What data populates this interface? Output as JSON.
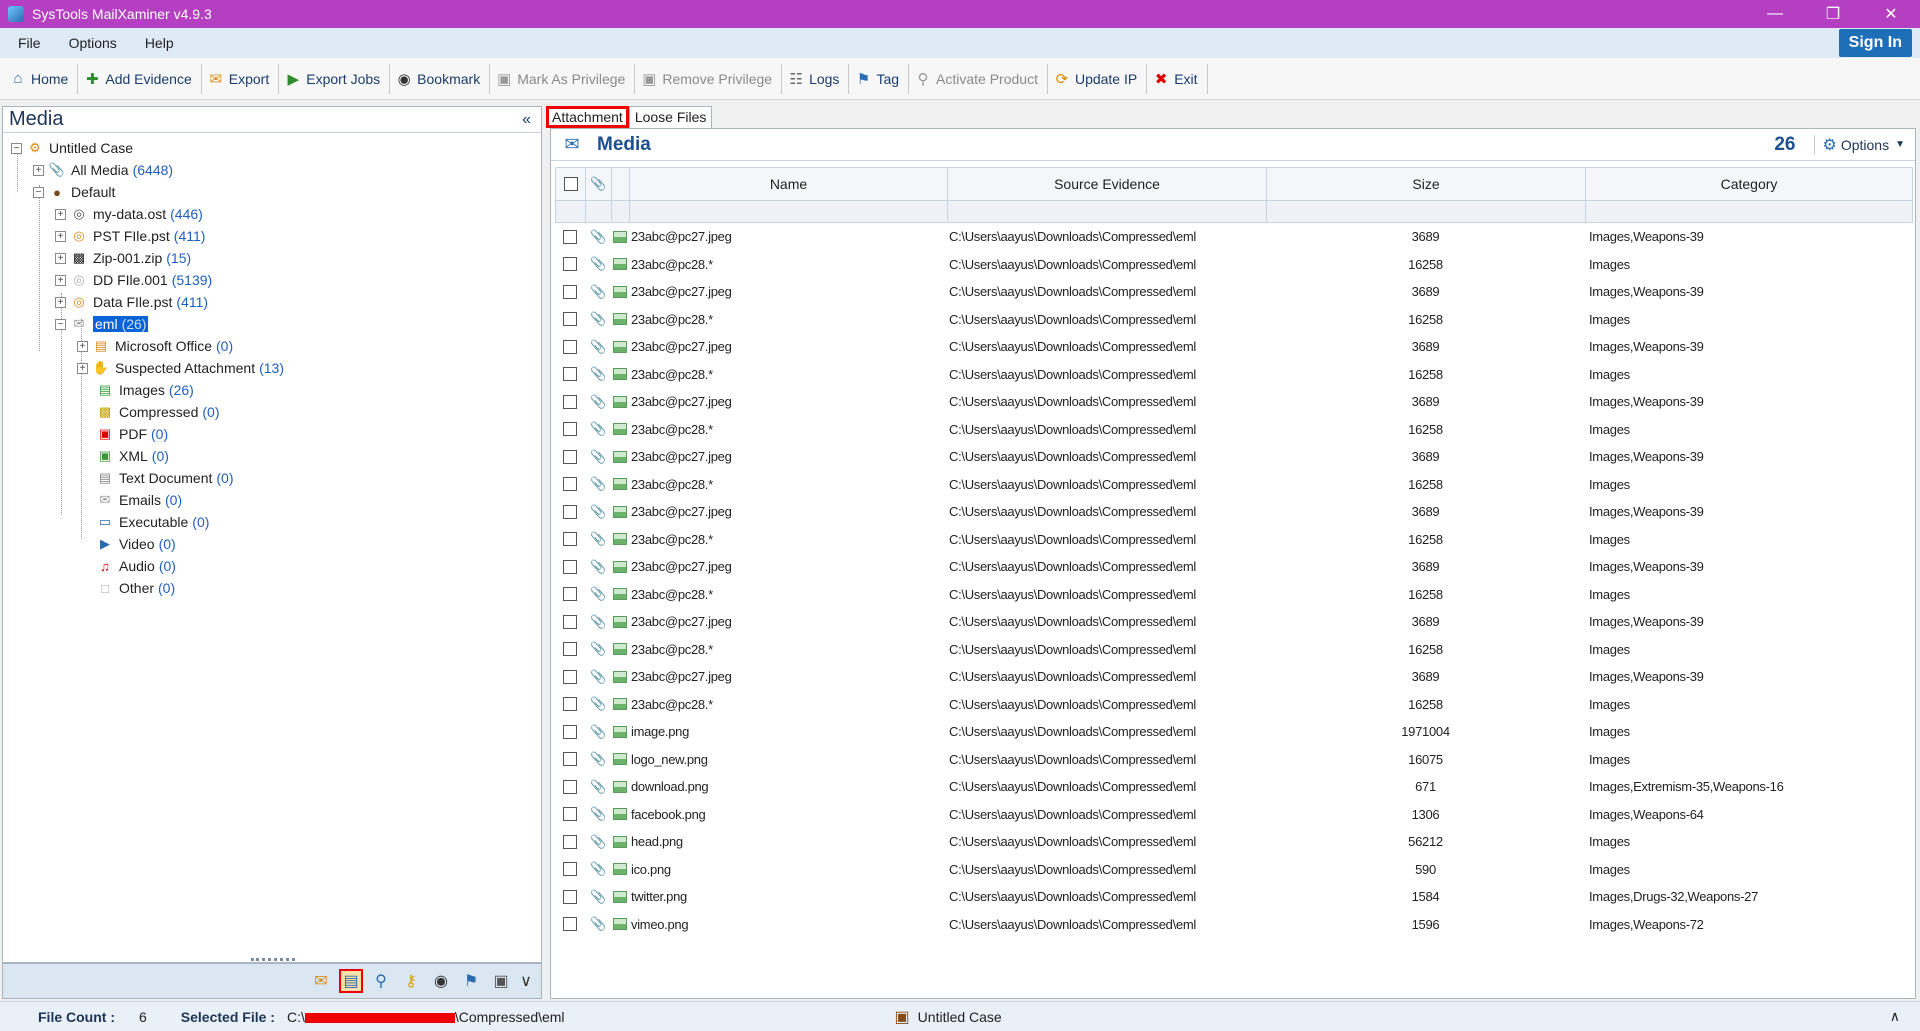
{
  "window": {
    "title": "SysTools MailXaminer v4.9.3"
  },
  "menu": {
    "items": [
      "File",
      "Options",
      "Help"
    ],
    "sign_in": "Sign In"
  },
  "toolbar": {
    "buttons": [
      {
        "label": "Home",
        "icon": "home-icon",
        "enabled": true
      },
      {
        "label": "Add Evidence",
        "icon": "add-evidence-icon",
        "enabled": true
      },
      {
        "label": "Export",
        "icon": "export-icon",
        "enabled": true
      },
      {
        "label": "Export Jobs",
        "icon": "play-icon",
        "enabled": true
      },
      {
        "label": "Bookmark",
        "icon": "eye-icon",
        "enabled": true
      },
      {
        "label": "Mark As Privilege",
        "icon": "lock-icon",
        "enabled": false
      },
      {
        "label": "Remove Privilege",
        "icon": "unlock-icon",
        "enabled": false
      },
      {
        "label": "Logs",
        "icon": "log-icon",
        "enabled": true
      },
      {
        "label": "Tag",
        "icon": "tag-icon",
        "enabled": true
      },
      {
        "label": "Activate Product",
        "icon": "key-icon",
        "enabled": false
      },
      {
        "label": "Update IP",
        "icon": "update-icon",
        "enabled": true
      },
      {
        "label": "Exit",
        "icon": "close-icon",
        "enabled": true
      }
    ]
  },
  "left_panel": {
    "title": "Media",
    "tree": {
      "case": "Untitled Case",
      "all_media": {
        "label": "All Media",
        "count": "(6448)"
      },
      "default": "Default",
      "sources": [
        {
          "label": "my-data.ost",
          "count": "(446)"
        },
        {
          "label": "PST FIle.pst",
          "count": "(411)"
        },
        {
          "label": "Zip-001.zip",
          "count": "(15)"
        },
        {
          "label": "DD FIle.001",
          "count": "(5139)"
        },
        {
          "label": "Data FIle.pst",
          "count": "(411)"
        },
        {
          "label": "eml",
          "count": "(26)"
        }
      ],
      "categories": [
        {
          "label": "Microsoft Office",
          "count": "(0)"
        },
        {
          "label": "Suspected Attachment",
          "count": "(13)"
        },
        {
          "label": "Images",
          "count": "(26)"
        },
        {
          "label": "Compressed",
          "count": "(0)"
        },
        {
          "label": "PDF",
          "count": "(0)"
        },
        {
          "label": "XML",
          "count": "(0)"
        },
        {
          "label": "Text Document",
          "count": "(0)"
        },
        {
          "label": "Emails",
          "count": "(0)"
        },
        {
          "label": "Executable",
          "count": "(0)"
        },
        {
          "label": "Video",
          "count": "(0)"
        },
        {
          "label": "Audio",
          "count": "(0)"
        },
        {
          "label": "Other",
          "count": "(0)"
        }
      ]
    }
  },
  "tabs": [
    "Attachment",
    "Loose Files"
  ],
  "media": {
    "title": "Media",
    "count": "26",
    "options_label": "Options"
  },
  "grid": {
    "columns": [
      "Name",
      "Source Evidence",
      "Size",
      "Category"
    ],
    "rows": [
      {
        "name": "23abc@pc27.jpeg",
        "source": "C:\\Users\\aayus\\Downloads\\Compressed\\eml",
        "size": "3689",
        "category": "Images,Weapons-39"
      },
      {
        "name": "23abc@pc28.*",
        "source": "C:\\Users\\aayus\\Downloads\\Compressed\\eml",
        "size": "16258",
        "category": "Images"
      },
      {
        "name": "23abc@pc27.jpeg",
        "source": "C:\\Users\\aayus\\Downloads\\Compressed\\eml",
        "size": "3689",
        "category": "Images,Weapons-39"
      },
      {
        "name": "23abc@pc28.*",
        "source": "C:\\Users\\aayus\\Downloads\\Compressed\\eml",
        "size": "16258",
        "category": "Images"
      },
      {
        "name": "23abc@pc27.jpeg",
        "source": "C:\\Users\\aayus\\Downloads\\Compressed\\eml",
        "size": "3689",
        "category": "Images,Weapons-39"
      },
      {
        "name": "23abc@pc28.*",
        "source": "C:\\Users\\aayus\\Downloads\\Compressed\\eml",
        "size": "16258",
        "category": "Images"
      },
      {
        "name": "23abc@pc27.jpeg",
        "source": "C:\\Users\\aayus\\Downloads\\Compressed\\eml",
        "size": "3689",
        "category": "Images,Weapons-39"
      },
      {
        "name": "23abc@pc28.*",
        "source": "C:\\Users\\aayus\\Downloads\\Compressed\\eml",
        "size": "16258",
        "category": "Images"
      },
      {
        "name": "23abc@pc27.jpeg",
        "source": "C:\\Users\\aayus\\Downloads\\Compressed\\eml",
        "size": "3689",
        "category": "Images,Weapons-39"
      },
      {
        "name": "23abc@pc28.*",
        "source": "C:\\Users\\aayus\\Downloads\\Compressed\\eml",
        "size": "16258",
        "category": "Images"
      },
      {
        "name": "23abc@pc27.jpeg",
        "source": "C:\\Users\\aayus\\Downloads\\Compressed\\eml",
        "size": "3689",
        "category": "Images,Weapons-39"
      },
      {
        "name": "23abc@pc28.*",
        "source": "C:\\Users\\aayus\\Downloads\\Compressed\\eml",
        "size": "16258",
        "category": "Images"
      },
      {
        "name": "23abc@pc27.jpeg",
        "source": "C:\\Users\\aayus\\Downloads\\Compressed\\eml",
        "size": "3689",
        "category": "Images,Weapons-39"
      },
      {
        "name": "23abc@pc28.*",
        "source": "C:\\Users\\aayus\\Downloads\\Compressed\\eml",
        "size": "16258",
        "category": "Images"
      },
      {
        "name": "23abc@pc27.jpeg",
        "source": "C:\\Users\\aayus\\Downloads\\Compressed\\eml",
        "size": "3689",
        "category": "Images,Weapons-39"
      },
      {
        "name": "23abc@pc28.*",
        "source": "C:\\Users\\aayus\\Downloads\\Compressed\\eml",
        "size": "16258",
        "category": "Images"
      },
      {
        "name": "23abc@pc27.jpeg",
        "source": "C:\\Users\\aayus\\Downloads\\Compressed\\eml",
        "size": "3689",
        "category": "Images,Weapons-39"
      },
      {
        "name": "23abc@pc28.*",
        "source": "C:\\Users\\aayus\\Downloads\\Compressed\\eml",
        "size": "16258",
        "category": "Images"
      },
      {
        "name": "image.png",
        "source": "C:\\Users\\aayus\\Downloads\\Compressed\\eml",
        "size": "1971004",
        "category": "Images"
      },
      {
        "name": "logo_new.png",
        "source": "C:\\Users\\aayus\\Downloads\\Compressed\\eml",
        "size": "16075",
        "category": "Images"
      },
      {
        "name": "download.png",
        "source": "C:\\Users\\aayus\\Downloads\\Compressed\\eml",
        "size": "671",
        "category": "Images,Extremism-35,Weapons-16"
      },
      {
        "name": "facebook.png",
        "source": "C:\\Users\\aayus\\Downloads\\Compressed\\eml",
        "size": "1306",
        "category": "Images,Weapons-64"
      },
      {
        "name": "head.png",
        "source": "C:\\Users\\aayus\\Downloads\\Compressed\\eml",
        "size": "56212",
        "category": "Images"
      },
      {
        "name": "ico.png",
        "source": "C:\\Users\\aayus\\Downloads\\Compressed\\eml",
        "size": "590",
        "category": "Images"
      },
      {
        "name": "twitter.png",
        "source": "C:\\Users\\aayus\\Downloads\\Compressed\\eml",
        "size": "1584",
        "category": "Images,Drugs-32,Weapons-27"
      },
      {
        "name": "vimeo.png",
        "source": "C:\\Users\\aayus\\Downloads\\Compressed\\eml",
        "size": "1596",
        "category": "Images,Weapons-72"
      }
    ]
  },
  "statusbar": {
    "file_count_label": "File Count :",
    "file_count": "6",
    "selected_file_label": "Selected File :",
    "selected_file_prefix": "C:\\",
    "selected_file_suffix": "\\Compressed\\eml",
    "case_name": "Untitled Case"
  }
}
